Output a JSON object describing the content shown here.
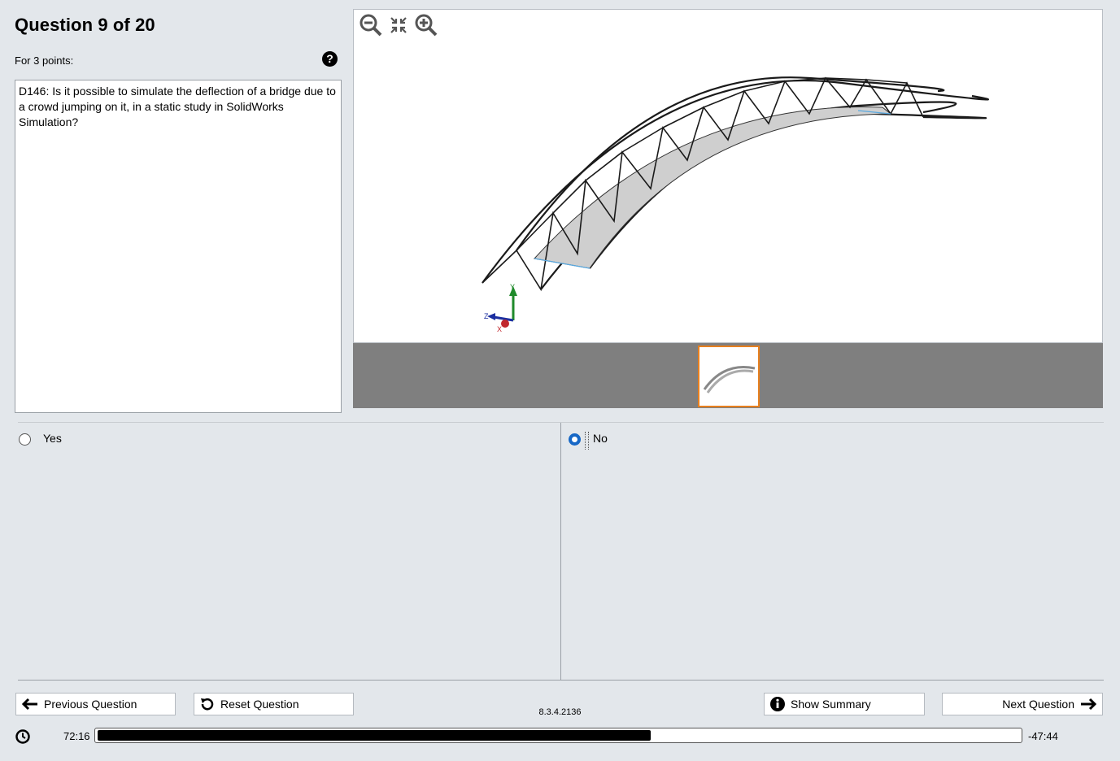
{
  "question": {
    "title": "Question 9 of 20",
    "points": "For 3 points:",
    "text": "D146: Is it possible to simulate the deflection of a bridge due to a crowd jumping on it, in a static study in SolidWorks Simulation?"
  },
  "viewer": {
    "tools": [
      "zoom-out-icon",
      "fit-icon",
      "zoom-in-icon"
    ],
    "axis_labels": {
      "y": "Y",
      "z": "Z",
      "x": "X"
    }
  },
  "answers": [
    {
      "label": "Yes",
      "selected": false
    },
    {
      "label": "No",
      "selected": true
    }
  ],
  "buttons": {
    "previous": "Previous Question",
    "reset": "Reset Question",
    "summary": "Show Summary",
    "next": "Next Question"
  },
  "version": "8.3.4.2136",
  "timer": {
    "elapsed": "72:16",
    "remaining": "-47:44",
    "progress_fraction": 0.6
  },
  "colors": {
    "radio_selected": "#1768c6",
    "thumb_border": "#e8801e"
  }
}
